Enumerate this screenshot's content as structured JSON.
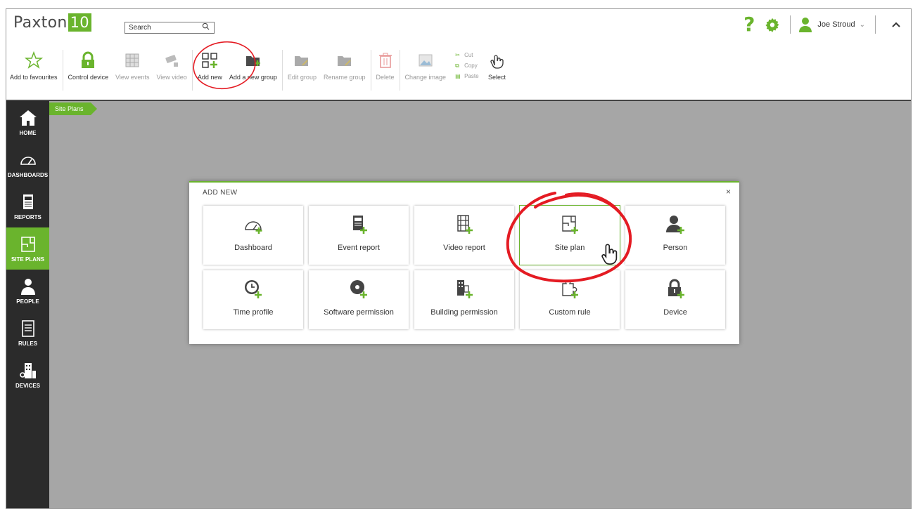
{
  "app": {
    "brand_name": "Paxton",
    "brand_version": "10",
    "search": {
      "placeholder": "Search"
    },
    "user": {
      "name": "Joe Stroud"
    }
  },
  "toolbar": {
    "items": [
      {
        "label": "Add to favourites",
        "icon": "star-icon",
        "enabled": true
      },
      {
        "label": "Control device",
        "icon": "lock-icon",
        "enabled": true
      },
      {
        "label": "View events",
        "icon": "event-grid-icon",
        "enabled": false
      },
      {
        "label": "View video",
        "icon": "camera-icon",
        "enabled": false
      },
      {
        "label": "Add new",
        "icon": "add-grid-icon",
        "enabled": true
      },
      {
        "label": "Add a new group",
        "icon": "folder-add-icon",
        "enabled": true
      },
      {
        "label": "Edit group",
        "icon": "folder-edit-icon",
        "enabled": false
      },
      {
        "label": "Rename group",
        "icon": "folder-rename-icon",
        "enabled": false
      },
      {
        "label": "Delete",
        "icon": "trash-icon",
        "enabled": false
      },
      {
        "label": "Change image",
        "icon": "image-icon",
        "enabled": false
      }
    ],
    "clipboard": {
      "cut": "Cut",
      "copy": "Copy",
      "paste": "Paste"
    },
    "select_label": "Select"
  },
  "sidebar": {
    "items": [
      {
        "label": "HOME",
        "icon": "home-icon"
      },
      {
        "label": "DASHBOARDS",
        "icon": "gauge-icon"
      },
      {
        "label": "REPORTS",
        "icon": "report-icon"
      },
      {
        "label": "SITE PLANS",
        "icon": "site-plan-icon",
        "active": true
      },
      {
        "label": "PEOPLE",
        "icon": "person-icon"
      },
      {
        "label": "RULES",
        "icon": "rules-icon"
      },
      {
        "label": "DEVICES",
        "icon": "devices-icon"
      }
    ]
  },
  "breadcrumb": {
    "label": "Site Plans"
  },
  "modal": {
    "title": "ADD NEW",
    "close": "×",
    "cards": [
      {
        "label": "Dashboard",
        "icon": "dashboard-icon"
      },
      {
        "label": "Event report",
        "icon": "event-report-icon"
      },
      {
        "label": "Video report",
        "icon": "video-report-icon"
      },
      {
        "label": "Site plan",
        "icon": "site-plan-add-icon",
        "selected": true
      },
      {
        "label": "Person",
        "icon": "person-add-icon"
      },
      {
        "label": "Time profile",
        "icon": "clock-add-icon"
      },
      {
        "label": "Software permission",
        "icon": "disc-add-icon"
      },
      {
        "label": "Building permission",
        "icon": "building-add-icon"
      },
      {
        "label": "Custom rule",
        "icon": "puzzle-add-icon"
      },
      {
        "label": "Device",
        "icon": "lock-add-icon"
      }
    ]
  },
  "colors": {
    "accent": "#6ab42d",
    "sidebar": "#2b2b2b",
    "workspace": "#a6a6a6",
    "annotation": "#e41b23"
  }
}
